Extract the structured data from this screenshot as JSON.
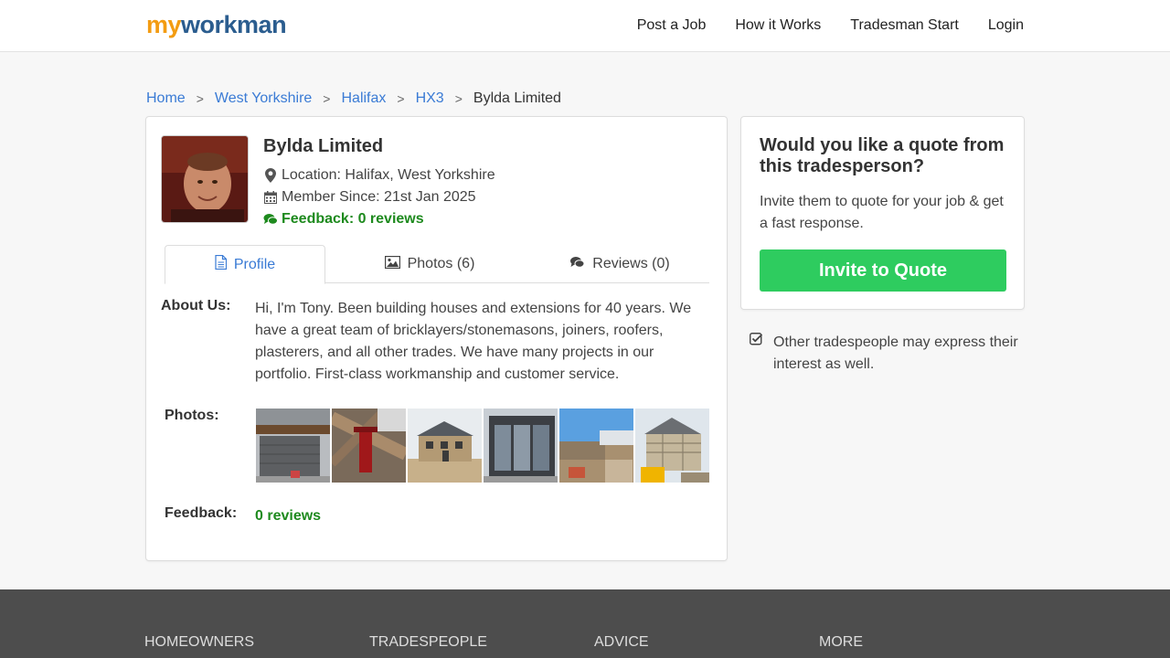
{
  "header": {
    "logo_my": "my",
    "logo_workman": "workman",
    "nav": [
      "Post a Job",
      "How it Works",
      "Tradesman Start",
      "Login"
    ]
  },
  "breadcrumb": {
    "items": [
      "Home",
      "West Yorkshire",
      "Halifax",
      "HX3"
    ],
    "separator": ">",
    "current": "Bylda Limited"
  },
  "profile": {
    "name": "Bylda Limited",
    "location": "Location: Halifax, West Yorkshire",
    "member_since": "Member Since: 21st Jan 2025",
    "feedback": "Feedback: 0 reviews",
    "tabs": [
      "Profile",
      "Photos (6)",
      "Reviews (0)"
    ],
    "about_label": "About Us:",
    "about_text": "Hi, I'm Tony. Been building houses and extensions for 40 years. We have a great team of bricklayers/stonemasons, joiners, roofers, plasterers, and all other trades. We have many projects in our portfolio. First-class workmanship and customer service.",
    "photos_label": "Photos:",
    "feedback_label": "Feedback:",
    "feedback_value": "0 reviews"
  },
  "quote": {
    "title": "Would you like a quote from this tradesperson?",
    "text": "Invite them to quote for your job & get a fast response.",
    "button": "Invite to Quote",
    "note": "Other tradespeople may express their interest as well."
  },
  "footer": {
    "columns": [
      "HOMEOWNERS",
      "TRADESPEOPLE",
      "ADVICE",
      "MORE"
    ]
  },
  "colors": {
    "link": "#3a7bd5",
    "success": "#1e8a1e",
    "cta": "#2ecc5f",
    "footer_bg": "#4d4d4d"
  }
}
